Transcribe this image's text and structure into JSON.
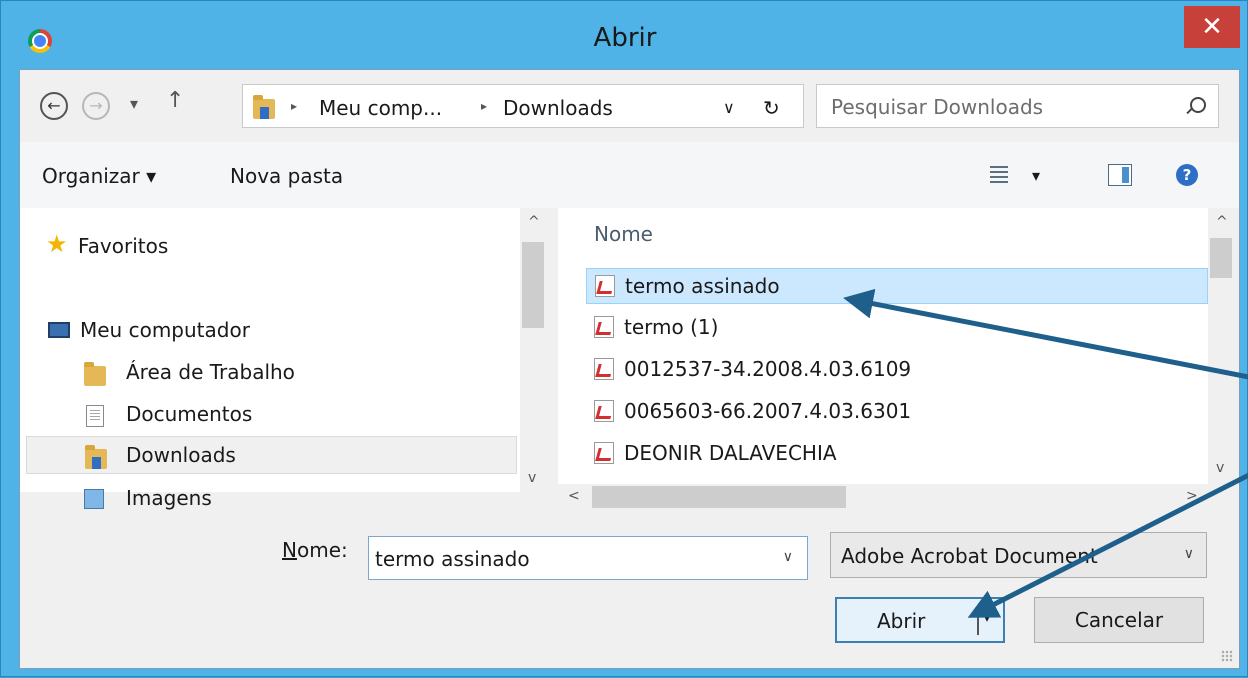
{
  "window": {
    "title": "Abrir",
    "close_glyph": "✕"
  },
  "address_bar": {
    "back_glyph": "←",
    "forward_glyph": "→",
    "recent_glyph": "▾",
    "up_glyph": "↑",
    "crumbs": [
      "Meu comp...",
      "Downloads"
    ],
    "separator_glyph": "▸",
    "dropdown_glyph": "∨",
    "refresh_glyph": "↻"
  },
  "search": {
    "placeholder": "Pesquisar Downloads"
  },
  "toolbar": {
    "organize_label": "Organizar ▾",
    "new_folder_label": "Nova pasta",
    "view_dropdown_glyph": "▾",
    "help_glyph": "?"
  },
  "nav": {
    "favorites": "Favoritos",
    "computer": "Meu computador",
    "items": [
      "Área de Trabalho",
      "Documentos",
      "Downloads",
      "Imagens"
    ],
    "selected": "Downloads"
  },
  "files": {
    "column_header": "Nome",
    "items": [
      "termo assinado",
      "termo (1)",
      "0012537-34.2008.4.03.6109",
      "0065603-66.2007.4.03.6301",
      "DEONIR DALAVECHIA"
    ],
    "selected": "termo assinado"
  },
  "scroll": {
    "up_glyph": "^",
    "down_glyph": "v",
    "left_glyph": "<",
    "right_glyph": ">"
  },
  "footer": {
    "name_label_prefix": "N",
    "name_label_rest": "ome:",
    "name_value": "termo assinado",
    "name_dropdown_glyph": "∨",
    "file_type": "Adobe Acrobat Document",
    "type_dropdown_glyph": "∨",
    "open_label": "Abrir",
    "open_split_glyph": "▾",
    "cancel_label": "Cancelar"
  },
  "annotation": {
    "arrow_color": "#1f5f8b"
  }
}
